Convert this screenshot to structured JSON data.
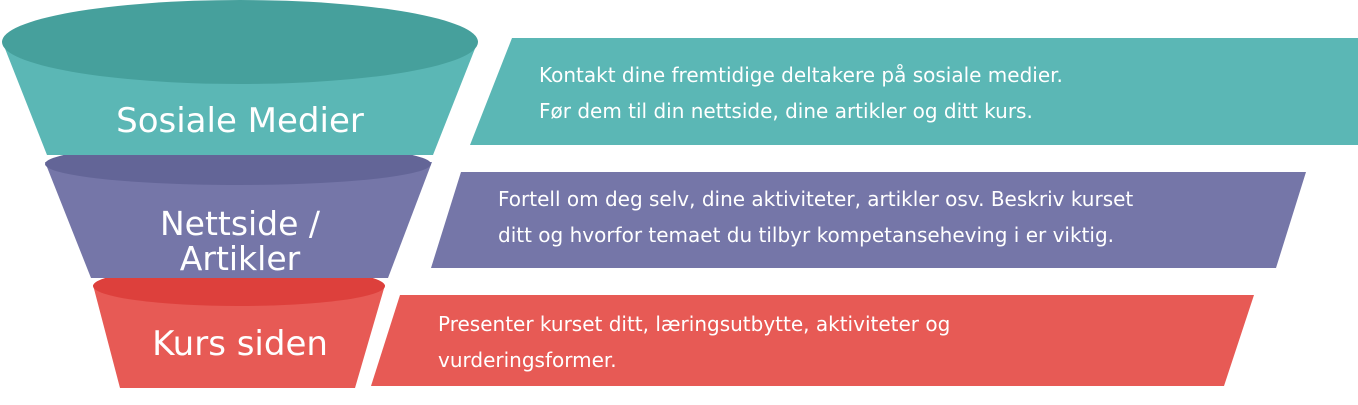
{
  "colors": {
    "teal": "#5bb7b5",
    "teal_dark": "#46a09c",
    "purple": "#7576a8",
    "purple_dark": "#636597",
    "red": "#e75a55",
    "red_dark": "#dd403c"
  },
  "stages": [
    {
      "label": "Sosiale Medier",
      "lines": [
        "Kontakt dine fremtidige deltakere på sosiale medier.",
        "Før dem til din nettside, dine artikler og ditt kurs."
      ]
    },
    {
      "label_lines": [
        "Nettside /",
        "Artikler"
      ],
      "lines": [
        "Fortell om deg selv, dine aktiviteter, artikler  osv. Beskriv kurset",
        "ditt og hvorfor temaet du tilbyr kompetanseheving i er viktig."
      ]
    },
    {
      "label": "Kurs siden",
      "lines": [
        "Presenter kurset ditt, læringsutbytte, aktiviteter og",
        "vurderingsformer."
      ]
    }
  ]
}
